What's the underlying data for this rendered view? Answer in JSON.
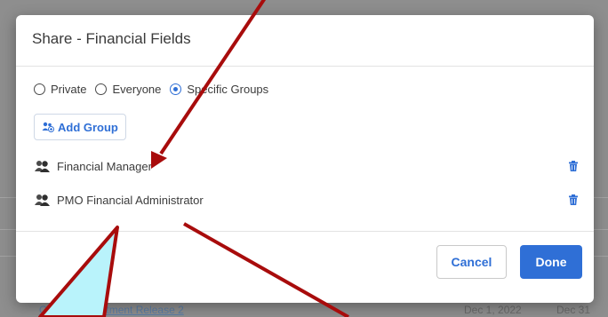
{
  "background": {
    "row_link": "Ontario Department Release 2",
    "date_1": "Dec 1, 2022",
    "date_2": "Dec 31"
  },
  "dialog": {
    "title": "Share - Financial Fields",
    "visibility": {
      "options": [
        "Private",
        "Everyone",
        "Specific Groups"
      ],
      "selected": "Specific Groups"
    },
    "add_group_label": "Add Group",
    "groups": [
      {
        "name": "Financial Manager",
        "icon": "people-icon",
        "action_icon": "trash-icon"
      },
      {
        "name": "PMO Financial Administrator",
        "icon": "people-icon",
        "action_icon": "trash-icon"
      }
    ],
    "cancel_label": "Cancel",
    "done_label": "Done"
  },
  "colors": {
    "accent": "#2f6fd6",
    "annotation_arrow": "#a80c0c",
    "annotation_callout": "#b9f3fb"
  }
}
